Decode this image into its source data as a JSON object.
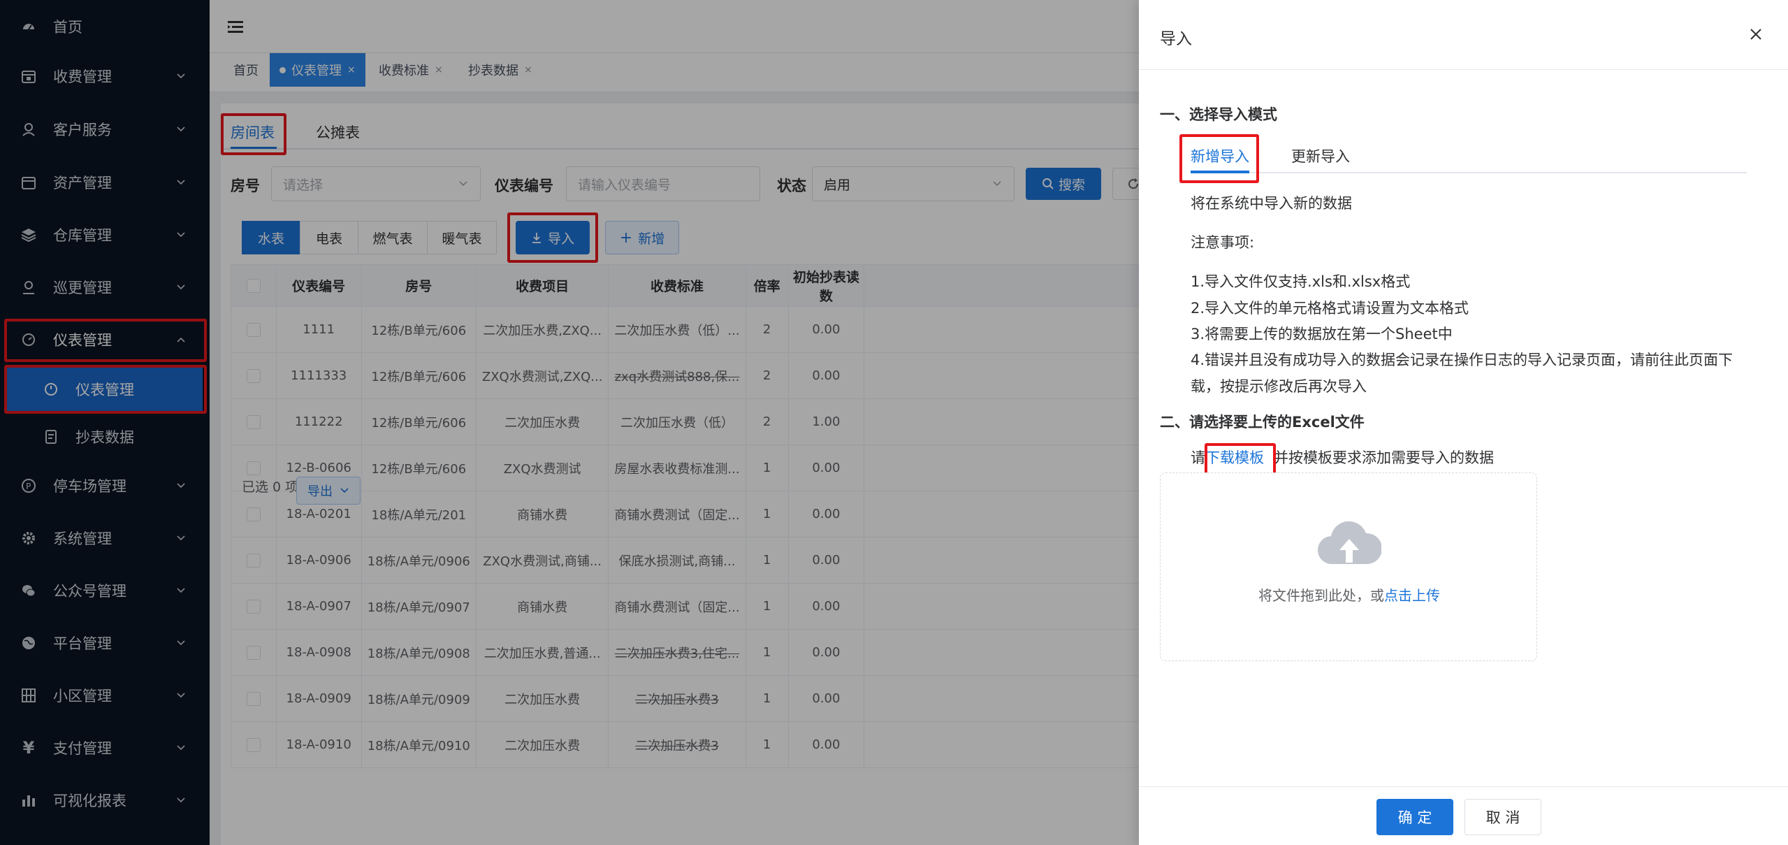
{
  "sidebar": {
    "items": [
      {
        "label": "首页",
        "icon": "dashboard-icon"
      },
      {
        "label": "收费管理",
        "icon": "calendar-icon"
      },
      {
        "label": "客户服务",
        "icon": "user-icon"
      },
      {
        "label": "资产管理",
        "icon": "calendar-icon"
      },
      {
        "label": "仓库管理",
        "icon": "layers-icon"
      },
      {
        "label": "巡更管理",
        "icon": "user-icon"
      },
      {
        "label": "仪表管理",
        "icon": "gauge-icon"
      },
      {
        "label": "仪表管理",
        "icon": "gauge-icon"
      },
      {
        "label": "抄表数据",
        "icon": "document-icon"
      },
      {
        "label": "停车场管理",
        "icon": "parking-icon"
      },
      {
        "label": "系统管理",
        "icon": "gear-icon"
      },
      {
        "label": "公众号管理",
        "icon": "wechat-icon"
      },
      {
        "label": "平台管理",
        "icon": "globe-icon"
      },
      {
        "label": "小区管理",
        "icon": "grid-icon"
      },
      {
        "label": "支付管理",
        "icon": "yen-icon"
      },
      {
        "label": "可视化报表",
        "icon": "bar-chart-icon"
      }
    ]
  },
  "header": {
    "menu_icon": "hamburger-icon"
  },
  "tags": [
    {
      "label": "首页",
      "closable": false
    },
    {
      "label": "仪表管理",
      "closable": true,
      "close": "×"
    },
    {
      "label": "收费标准",
      "closable": true,
      "close": "×"
    },
    {
      "label": "抄表数据",
      "closable": true,
      "close": "×"
    }
  ],
  "main": {
    "tabs": [
      "房间表",
      "公摊表"
    ],
    "filters": {
      "room_label": "房号",
      "room_placeholder": "请选择",
      "meter_label": "仪表编号",
      "meter_placeholder": "请输入仪表编号",
      "status_label": "状态",
      "status_value": "启用",
      "search_label": "搜索",
      "reset_icon": "refresh-icon"
    },
    "meter_types": [
      "水表",
      "电表",
      "燃气表",
      "暖气表"
    ],
    "import_label": "导入",
    "add_label": "新增",
    "table": {
      "headers": [
        "仪表编号",
        "房号",
        "收费项目",
        "收费标准",
        "倍率",
        "初始抄表读数"
      ],
      "rows": [
        [
          "1111",
          "12栋/B单元/606",
          "二次加压水费,ZXQ...",
          "二次加压水费（低）...",
          "2",
          "0.00"
        ],
        [
          "1111333",
          "12栋/B单元/606",
          "ZXQ水费测试,ZXQ...",
          "zxq水费测试888,保...",
          "2",
          "0.00"
        ],
        [
          "111222",
          "12栋/B单元/606",
          "二次加压水费",
          "二次加压水费（低）",
          "2",
          "1.00"
        ],
        [
          "12-B-0606",
          "12栋/B单元/606",
          "ZXQ水费测试",
          "房屋水表收费标准测...",
          "1",
          "0.00"
        ],
        [
          "18-A-0201",
          "18栋/A单元/201",
          "商铺水费",
          "商铺水费测试（固定...",
          "1",
          "0.00"
        ],
        [
          "18-A-0906",
          "18栋/A单元/0906",
          "ZXQ水费测试,商铺...",
          "保底水损测试,商铺...",
          "1",
          "0.00"
        ],
        [
          "18-A-0907",
          "18栋/A单元/0907",
          "商铺水费",
          "商铺水费测试（固定...",
          "1",
          "0.00"
        ],
        [
          "18-A-0908",
          "18栋/A单元/0908",
          "二次加压水费,普通...",
          "二次加压水费3,住宅...",
          "1",
          "0.00"
        ],
        [
          "18-A-0909",
          "18栋/A单元/0909",
          "二次加压水费",
          "二次加压水费3",
          "1",
          "0.00"
        ],
        [
          "18-A-0910",
          "18栋/A单元/0910",
          "二次加压水费",
          "二次加压水费3",
          "1",
          "0.00"
        ]
      ]
    },
    "selected_text": "已选 0 项",
    "export_label": "导出"
  },
  "drawer": {
    "title": "导入",
    "section1": "一、选择导入模式",
    "mode_tabs": [
      "新增导入",
      "更新导入"
    ],
    "mode_desc": "将在系统中导入新的数据",
    "notes_title": "注意事项:",
    "notes": [
      "1.导入文件仅支持.xls和.xlsx格式",
      "2.导入文件的单元格格式请设置为文本格式",
      "3.将需要上传的数据放在第一个Sheet中",
      "4.错误并且没有成功导入的数据会记录在操作日志的导入记录页面，请前往此页面下",
      "载，按提示修改后再次导入"
    ],
    "section2": "二、请选择要上传的Excel文件",
    "template_prefix": "请",
    "template_link": "下载模板",
    "template_suffix": "并按模板要求添加需要导入的数据",
    "upload_text": "将文件拖到此处，或",
    "upload_link": "点击上传",
    "confirm_label": "确 定",
    "cancel_label": "取 消"
  },
  "colors": {
    "primary": "#1c74d8",
    "sidebar_bg": "#0a1523",
    "highlight": "#e8171c"
  }
}
